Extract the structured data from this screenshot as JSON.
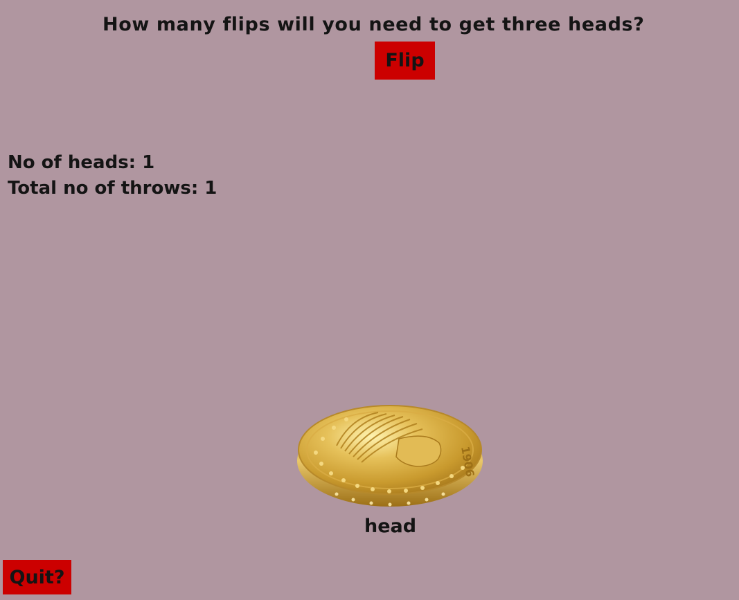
{
  "header": {
    "question": "How many flips will you need to get three heads?"
  },
  "controls": {
    "flip_label": "Flip",
    "quit_label": "Quit?"
  },
  "stats": {
    "heads_text": "No of heads: 1",
    "throws_text": "Total no of throws: 1"
  },
  "coin": {
    "result_label": "head",
    "year": "1906"
  },
  "colors": {
    "background": "#b096a0",
    "button": "#cc0000",
    "text": "#141414"
  }
}
